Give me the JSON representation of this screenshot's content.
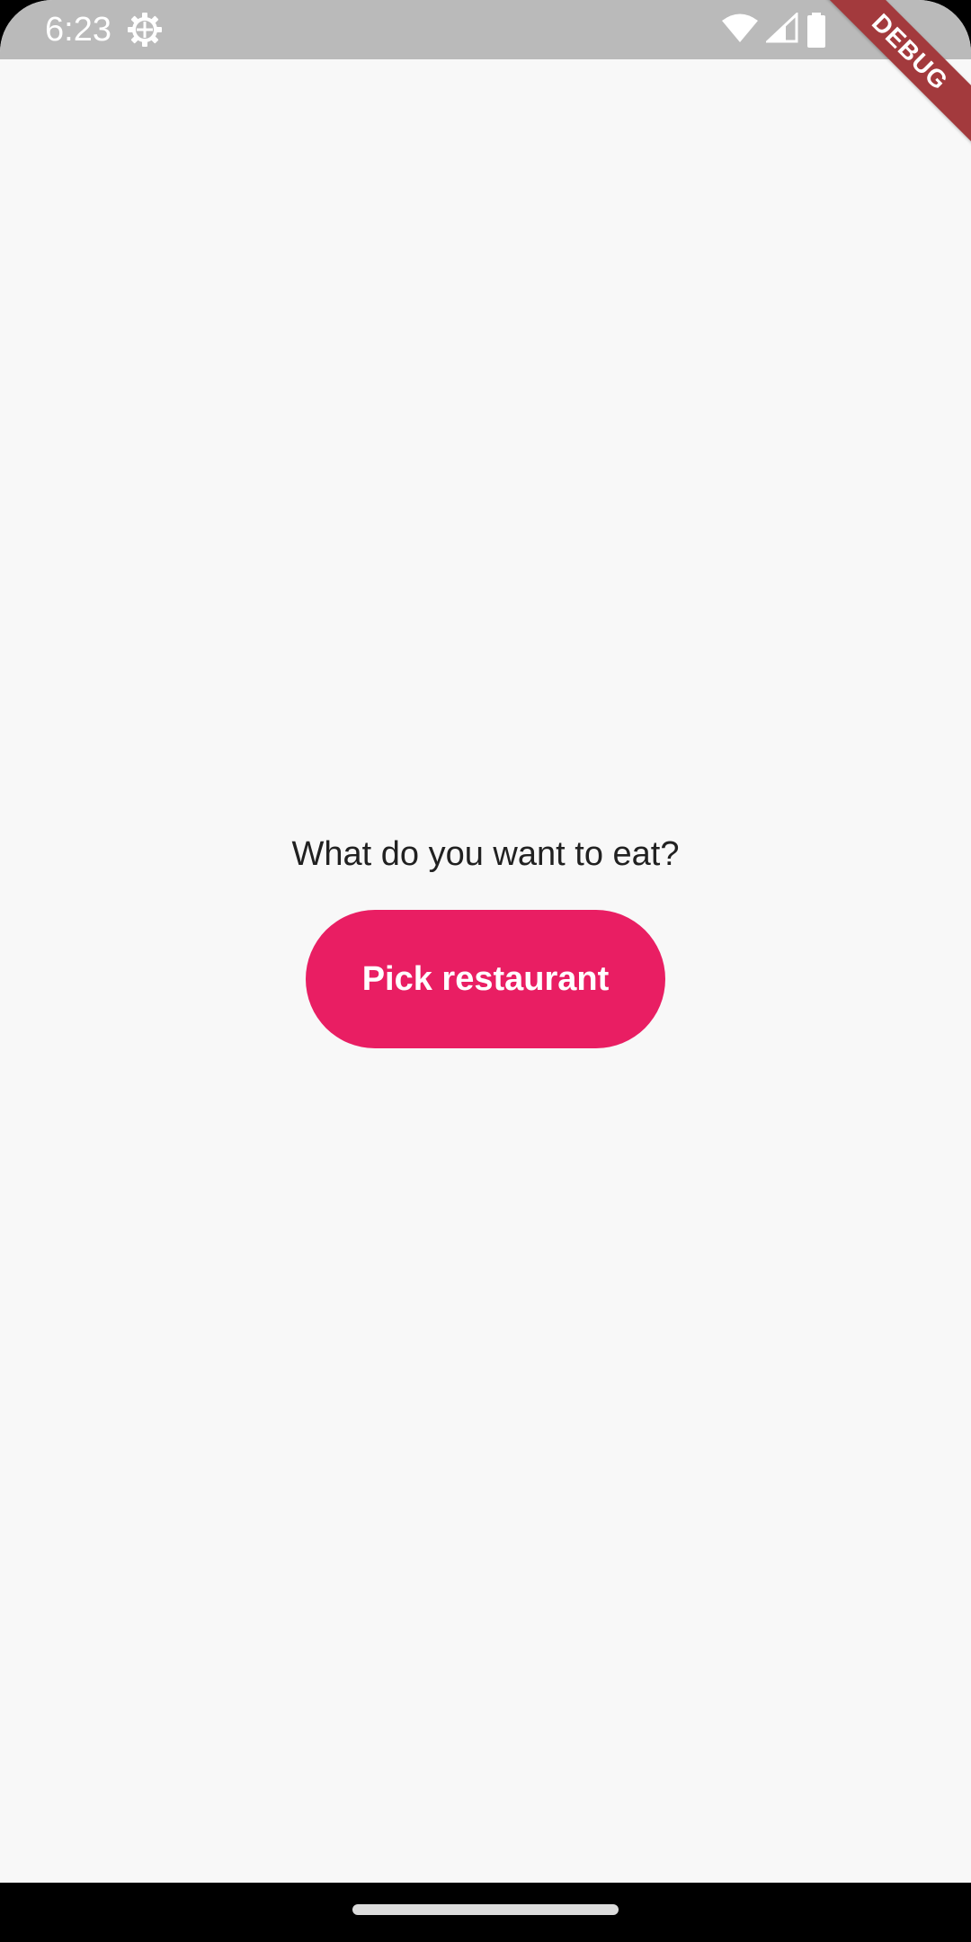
{
  "status_bar": {
    "time": "6:23",
    "icons": [
      "gear-icon",
      "wifi-icon",
      "cellular-signal-icon",
      "battery-icon"
    ],
    "background": "#bababa"
  },
  "debug_banner": {
    "label": "DEBUG",
    "color": "#a33a3d"
  },
  "main": {
    "prompt": "What do you want to eat?",
    "button_label": "Pick restaurant",
    "button_color": "#e91e63",
    "background": "#f8f8f8"
  },
  "nav_bar": {
    "icons": [
      "home-gesture-pill"
    ]
  }
}
